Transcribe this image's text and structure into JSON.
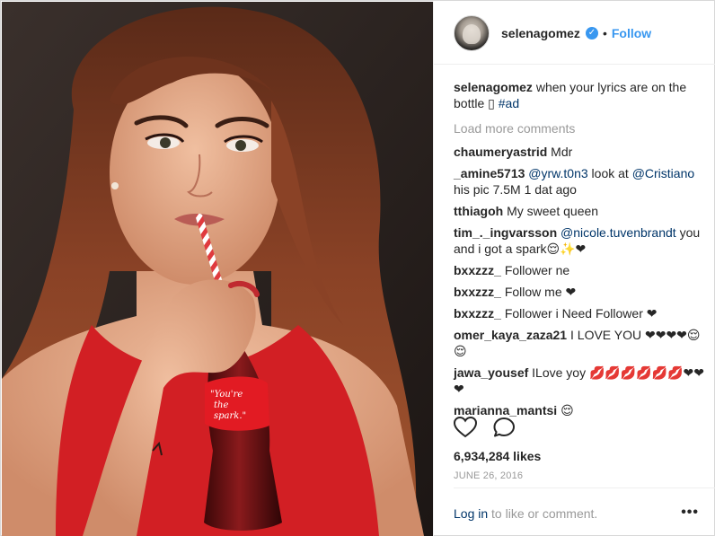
{
  "post": {
    "username": "selenagomez",
    "verified_icon": "verified-badge-icon",
    "separator": "•",
    "follow_label": "Follow",
    "caption": {
      "user": "selenagomez",
      "text": "when your lyrics are on the bottle",
      "emoji": "▯",
      "hashtag": "#ad"
    },
    "load_more_label": "Load more comments",
    "likes": "6,934,284 likes",
    "date": "JUNE 26, 2016",
    "login_link": "Log in",
    "login_rest": "to like or comment.",
    "more_label": "•••"
  },
  "comments": [
    {
      "user": "chaumeryastrid",
      "parts": [
        {
          "t": "text",
          "v": "Mdr"
        }
      ]
    },
    {
      "user": "_amine5713",
      "parts": [
        {
          "t": "mention",
          "v": "@yrw.t0n3"
        },
        {
          "t": "text",
          "v": "look at"
        },
        {
          "t": "mention",
          "v": "@Cristiano"
        },
        {
          "t": "text",
          "v": "his pic 7.5M 1 dat ago"
        }
      ]
    },
    {
      "user": "tthiagoh",
      "parts": [
        {
          "t": "text",
          "v": "My sweet queen"
        }
      ]
    },
    {
      "user": "tim_._ingvarsson",
      "parts": [
        {
          "t": "mention",
          "v": "@nicole.tuvenbrandt"
        },
        {
          "t": "text",
          "v": "you and i got a spark😌✨❤"
        }
      ]
    },
    {
      "user": "bxxzzz_",
      "parts": [
        {
          "t": "text",
          "v": "Follower ne"
        }
      ]
    },
    {
      "user": "bxxzzz_",
      "parts": [
        {
          "t": "text",
          "v": "Follow me ❤"
        }
      ]
    },
    {
      "user": "bxxzzz_",
      "parts": [
        {
          "t": "text",
          "v": "Follower i Need Follower ❤"
        }
      ]
    },
    {
      "user": "omer_kaya_zaza21",
      "parts": [
        {
          "t": "text",
          "v": "I LOVE YOU ❤❤❤❤😌😌"
        }
      ]
    },
    {
      "user": "jawa_yousef",
      "parts": [
        {
          "t": "text",
          "v": "ILove yoy 💋💋💋💋💋💋❤❤❤"
        }
      ]
    },
    {
      "user": "marianna_mantsi",
      "parts": [
        {
          "t": "text",
          "v": "😌"
        }
      ]
    }
  ],
  "photo": {
    "bottle_label": "You're the spark.",
    "colors": {
      "background": "#2b2320",
      "hair": "#7a3a22",
      "skin": "#e3a787",
      "top": "#d21f24",
      "bottle": "#6b0f12",
      "label": "#e21b23",
      "straw_red": "#e03a3e"
    }
  },
  "colors": {
    "accent": "#3897f0",
    "link": "#003569",
    "muted": "#999999",
    "text": "#262626"
  },
  "icons": [
    "heart-icon",
    "comment-icon",
    "more-options-icon"
  ]
}
